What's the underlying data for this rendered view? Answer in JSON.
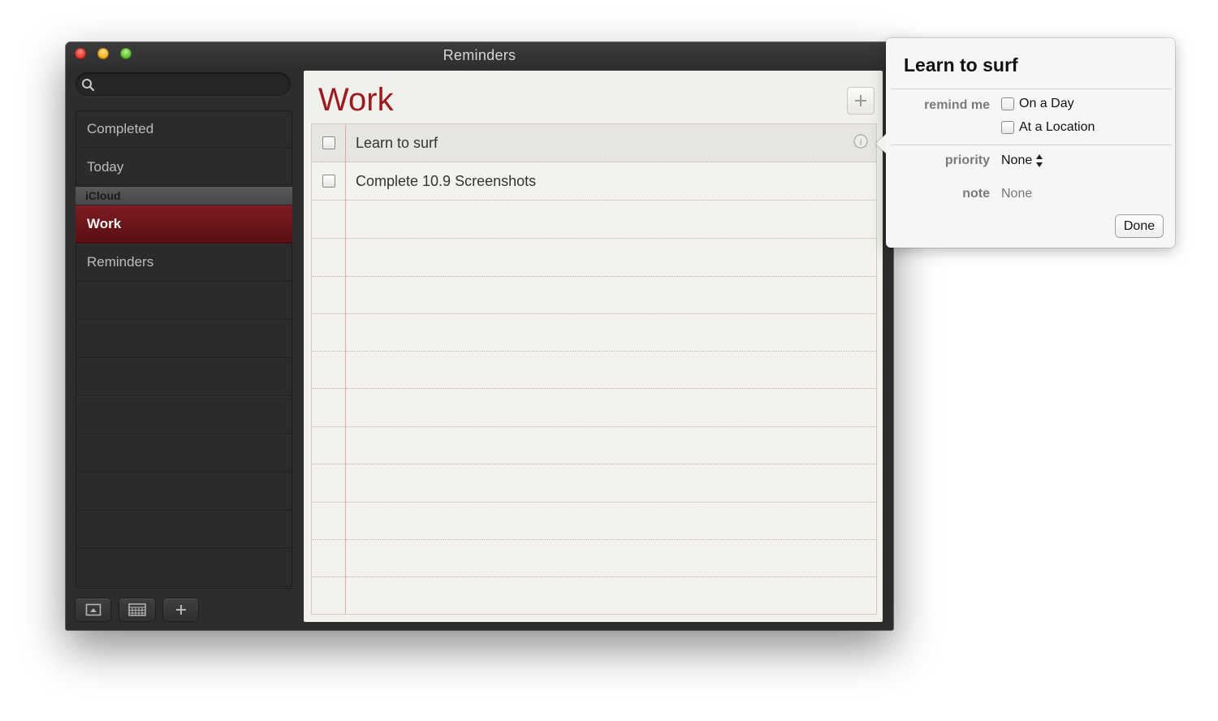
{
  "window": {
    "title": "Reminders"
  },
  "search": {
    "placeholder": ""
  },
  "sidebar": {
    "items": [
      {
        "label": "Completed"
      },
      {
        "label": "Today"
      }
    ],
    "section_header": "iCloud",
    "section_items": [
      {
        "label": "Work",
        "selected": true
      },
      {
        "label": "Reminders",
        "selected": false
      }
    ],
    "bottom_buttons": [
      "show-calendar-icon",
      "calendar-grid-icon",
      "plus-icon"
    ]
  },
  "list": {
    "title": "Work",
    "items": [
      {
        "text": "Learn to surf",
        "checked": false,
        "active": true
      },
      {
        "text": "Complete 10.9 Screenshots",
        "checked": false,
        "active": false
      }
    ]
  },
  "popover": {
    "title": "Learn to surf",
    "remind_me_label": "remind me",
    "option_day": "On a Day",
    "option_location": "At a Location",
    "priority_label": "priority",
    "priority_value": "None",
    "note_label": "note",
    "note_value": "None",
    "done_label": "Done"
  },
  "colors": {
    "accent_red": "#9b1c20",
    "selected_row": "#6b141a",
    "paper": "#f1f0ea"
  }
}
